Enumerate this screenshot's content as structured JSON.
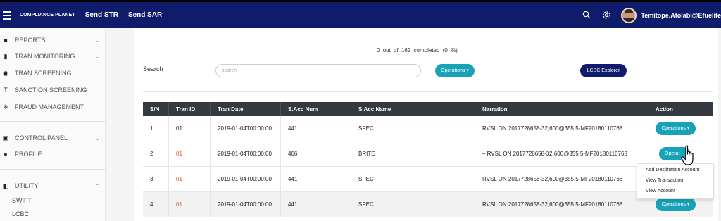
{
  "topbar": {
    "menu_icon": "hamburger-icon",
    "brand": "COMPLIANCE PLANET",
    "nav": [
      "Send STR",
      "Send SAR"
    ],
    "search_icon": "search-icon",
    "settings_icon": "gear-icon",
    "username": "Temitope.Afolabi@Efuelite"
  },
  "sidebar": {
    "items": [
      {
        "label": "REPORTS",
        "icon": "briefcase-icon",
        "chevron": "⌄"
      },
      {
        "label": "TRAN MONITORING",
        "icon": "bar-chart-icon",
        "chevron": "⌄"
      },
      {
        "label": "TRAN SCREENING",
        "icon": "globe-icon",
        "chevron": ""
      },
      {
        "label": "SANCTION SCREENING",
        "icon": "gavel-icon",
        "chevron": ""
      },
      {
        "label": "FRAUD MANAGEMENT",
        "icon": "snowflake-icon",
        "chevron": ""
      },
      {
        "label": "CONTROL PANEL",
        "icon": "chart-box-icon",
        "chevron": "⌄"
      },
      {
        "label": "PROFILE",
        "icon": "user-icon",
        "chevron": ""
      },
      {
        "label": "UTILITY",
        "icon": "columns-icon",
        "chevron": "⌃"
      }
    ],
    "sub_items": [
      "SWIFT",
      "LCBC"
    ]
  },
  "main": {
    "status": {
      "completed_count": "0",
      "out_of": "out of",
      "total": "162",
      "completed": "completed",
      "percent": "(0 %)"
    },
    "search_label": "Search",
    "search_placeholder": "search",
    "operations_label": "Operations ▾",
    "lcbc_label": "LCBC Explorer"
  },
  "table": {
    "headers": [
      "S/N",
      "Tran ID",
      "Tran Date",
      "S.Acc Num",
      "S.Acc Name",
      "Narration",
      "Action"
    ],
    "rows": [
      {
        "sn": "1",
        "tran_id": "01",
        "tran_date": "2019-01-04T00:00:00",
        "acc_num": "441",
        "acc_name": "SPEC",
        "narration": "RVSL ON 2017728658-32,600@355.5-MF20180110768",
        "action": "Operations ▾"
      },
      {
        "sn": "2",
        "tran_id": "01",
        "tran_date": "2019-01-04T00:00:00",
        "acc_num": "406",
        "acc_name": "BRITE",
        "narration": "– RVSL ON 2017728658-32,600@355.5-MF20180110768",
        "action": "Operat"
      },
      {
        "sn": "3",
        "tran_id": "01",
        "tran_date": "2019-01-04T00:00:00",
        "acc_num": "441",
        "acc_name": "SPEC",
        "narration": "RVSL ON 2017728658-32,600@355.5-MF20180110768",
        "action": ""
      },
      {
        "sn": "4",
        "tran_id": "01",
        "tran_date": "2019-01-04T00:00:00",
        "acc_num": "441",
        "acc_name": "SPEC",
        "narration": "RVSL ON 2017728658-32,600@355.5-MF20180110768",
        "action": "Operations ▾"
      }
    ]
  },
  "dropdown": {
    "items": [
      "Add Destination Account",
      "View Transaction",
      "View Account"
    ]
  },
  "colors": {
    "topbar": "#0f1c6b",
    "teal": "#17a2b8",
    "table_header": "#343a40",
    "tran_id_red": "#e0463a"
  }
}
